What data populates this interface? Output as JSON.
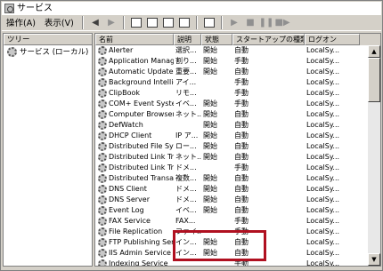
{
  "window": {
    "title": "サービス"
  },
  "menu": [
    "操作(A)",
    "表示(V)"
  ],
  "toolbar": {
    "buttons": [
      "back-icon",
      "forward-icon",
      "up-icon",
      "properties-icon",
      "refresh-icon",
      "export-icon",
      "help-icon",
      "play-icon",
      "stop-icon",
      "pause-icon",
      "restart-icon"
    ]
  },
  "tree": {
    "header": "ツリー",
    "items": [
      {
        "label": "サービス (ローカル)"
      }
    ]
  },
  "table": {
    "columns": [
      "名前",
      "説明",
      "状態",
      "スタートアップの種類",
      "ログオン"
    ],
    "rows": [
      {
        "name": "Alerter",
        "desc": "選択...",
        "status": "開始",
        "start": "自動",
        "logon": "LocalSy..."
      },
      {
        "name": "Application Manage...",
        "desc": "割り...",
        "status": "開始",
        "start": "手動",
        "logon": "LocalSy..."
      },
      {
        "name": "Automatic Updates",
        "desc": "重要...",
        "status": "開始",
        "start": "自動",
        "logon": "LocalSy..."
      },
      {
        "name": "Background Intellig...",
        "desc": "アイ...",
        "status": "",
        "start": "手動",
        "logon": "LocalSy..."
      },
      {
        "name": "ClipBook",
        "desc": "リモ...",
        "status": "",
        "start": "手動",
        "logon": "LocalSy..."
      },
      {
        "name": "COM+ Event System",
        "desc": "イベ...",
        "status": "開始",
        "start": "手動",
        "logon": "LocalSy..."
      },
      {
        "name": "Computer Browser",
        "desc": "ネット...",
        "status": "開始",
        "start": "自動",
        "logon": "LocalSy..."
      },
      {
        "name": "DefWatch",
        "desc": "",
        "status": "開始",
        "start": "自動",
        "logon": "LocalSy..."
      },
      {
        "name": "DHCP Client",
        "desc": "IP ア...",
        "status": "開始",
        "start": "自動",
        "logon": "LocalSy..."
      },
      {
        "name": "Distributed File Sys...",
        "desc": "ロー...",
        "status": "開始",
        "start": "自動",
        "logon": "LocalSy..."
      },
      {
        "name": "Distributed Link Tra...",
        "desc": "ネット...",
        "status": "開始",
        "start": "自動",
        "logon": "LocalSy..."
      },
      {
        "name": "Distributed Link Tra...",
        "desc": "ドメ...",
        "status": "",
        "start": "手動",
        "logon": "LocalSy..."
      },
      {
        "name": "Distributed Transac...",
        "desc": "複数...",
        "status": "開始",
        "start": "自動",
        "logon": "LocalSy..."
      },
      {
        "name": "DNS Client",
        "desc": "ドメ...",
        "status": "開始",
        "start": "自動",
        "logon": "LocalSy..."
      },
      {
        "name": "DNS Server",
        "desc": "ドメ...",
        "status": "開始",
        "start": "自動",
        "logon": "LocalSy..."
      },
      {
        "name": "Event Log",
        "desc": "イベ...",
        "status": "開始",
        "start": "自動",
        "logon": "LocalSy..."
      },
      {
        "name": "FAX Service",
        "desc": "FAX...",
        "status": "",
        "start": "手動",
        "logon": "LocalSy..."
      },
      {
        "name": "File Replication",
        "desc": "ファイ...",
        "status": "",
        "start": "手動",
        "logon": "LocalSy..."
      },
      {
        "name": "FTP Publishing Ser...",
        "desc": "イン...",
        "status": "開始",
        "start": "自動",
        "logon": "LocalSy..."
      },
      {
        "name": "IIS Admin Service",
        "desc": "イン...",
        "status": "開始",
        "start": "自動",
        "logon": "LocalSy..."
      },
      {
        "name": "Indexing Service",
        "desc": "",
        "status": "",
        "start": "手動",
        "logon": "LocalSy..."
      }
    ]
  },
  "colors": {
    "highlight": "#b01020",
    "chrome": "#d4d0c8"
  }
}
